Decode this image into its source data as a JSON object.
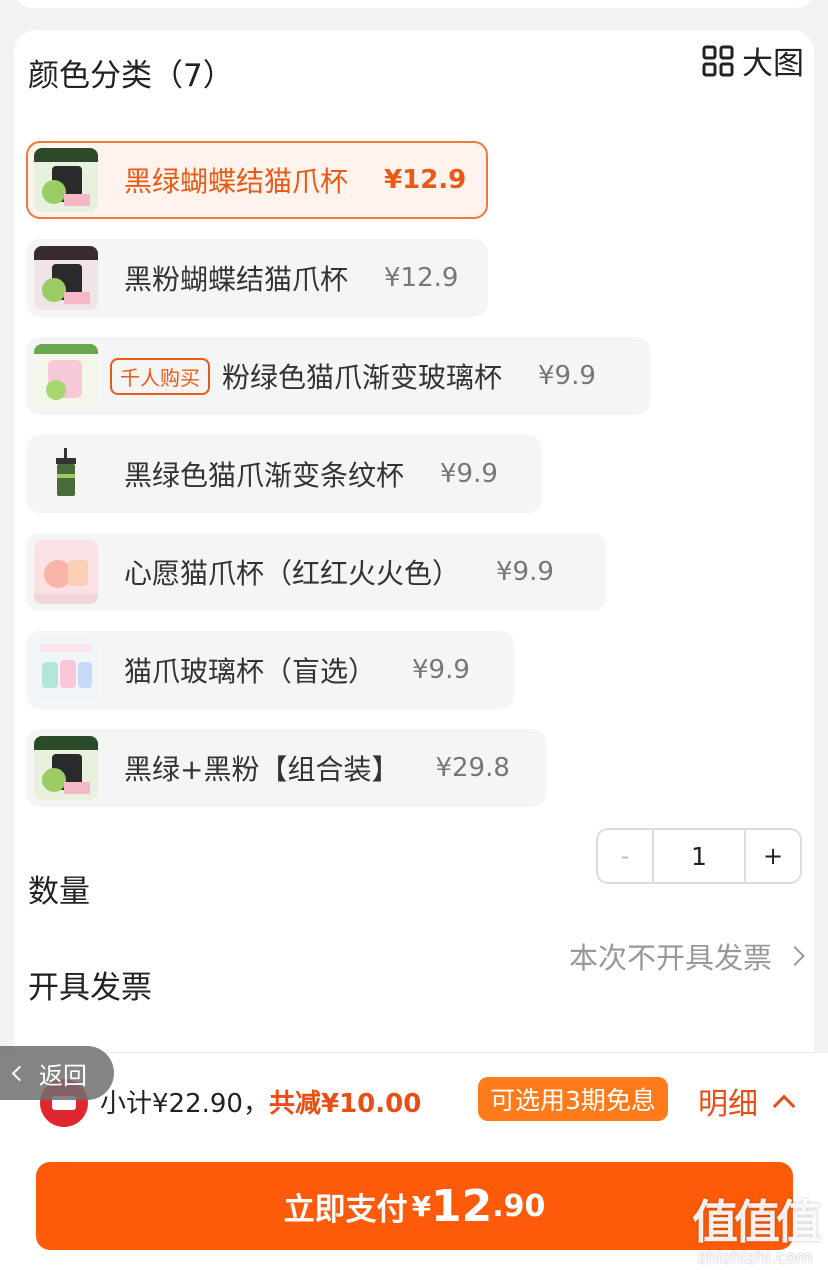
{
  "section": {
    "title": "颜色分类（7）",
    "big_view_label": "大图",
    "big_view_icon": "grid-icon"
  },
  "options": [
    {
      "name": "黑绿蝴蝶结猫爪杯",
      "price": "¥12.9",
      "selected": true
    },
    {
      "name": "黑粉蝴蝶结猫爪杯",
      "price": "¥12.9"
    },
    {
      "tag": "千人购买",
      "name": "粉绿色猫爪渐变玻璃杯",
      "price": "¥9.9"
    },
    {
      "name": "黑绿色猫爪渐变条纹杯",
      "price": "¥9.9"
    },
    {
      "name": "心愿猫爪杯（红红火火色）",
      "price": "¥9.9"
    },
    {
      "name": "猫爪玻璃杯（盲选）",
      "price": "¥9.9"
    },
    {
      "name": "黑绿+黑粉【组合装】",
      "price": "¥29.8"
    }
  ],
  "quantity": {
    "label": "数量",
    "value": "1",
    "minus": "-",
    "plus": "+"
  },
  "invoice": {
    "label": "开具发票",
    "value": "本次不开具发票"
  },
  "summary": {
    "subtotal": "小计¥22.90，",
    "discount": "共减¥10.00",
    "installment": "可选用3期免息",
    "detail": "明细"
  },
  "back": {
    "label": "返回"
  },
  "pay": {
    "label": "立即支付",
    "yen": "¥",
    "int": "12",
    "dec": ".90"
  },
  "watermark": {
    "logo": "值值值",
    "url": "zhizhizhi.com"
  }
}
